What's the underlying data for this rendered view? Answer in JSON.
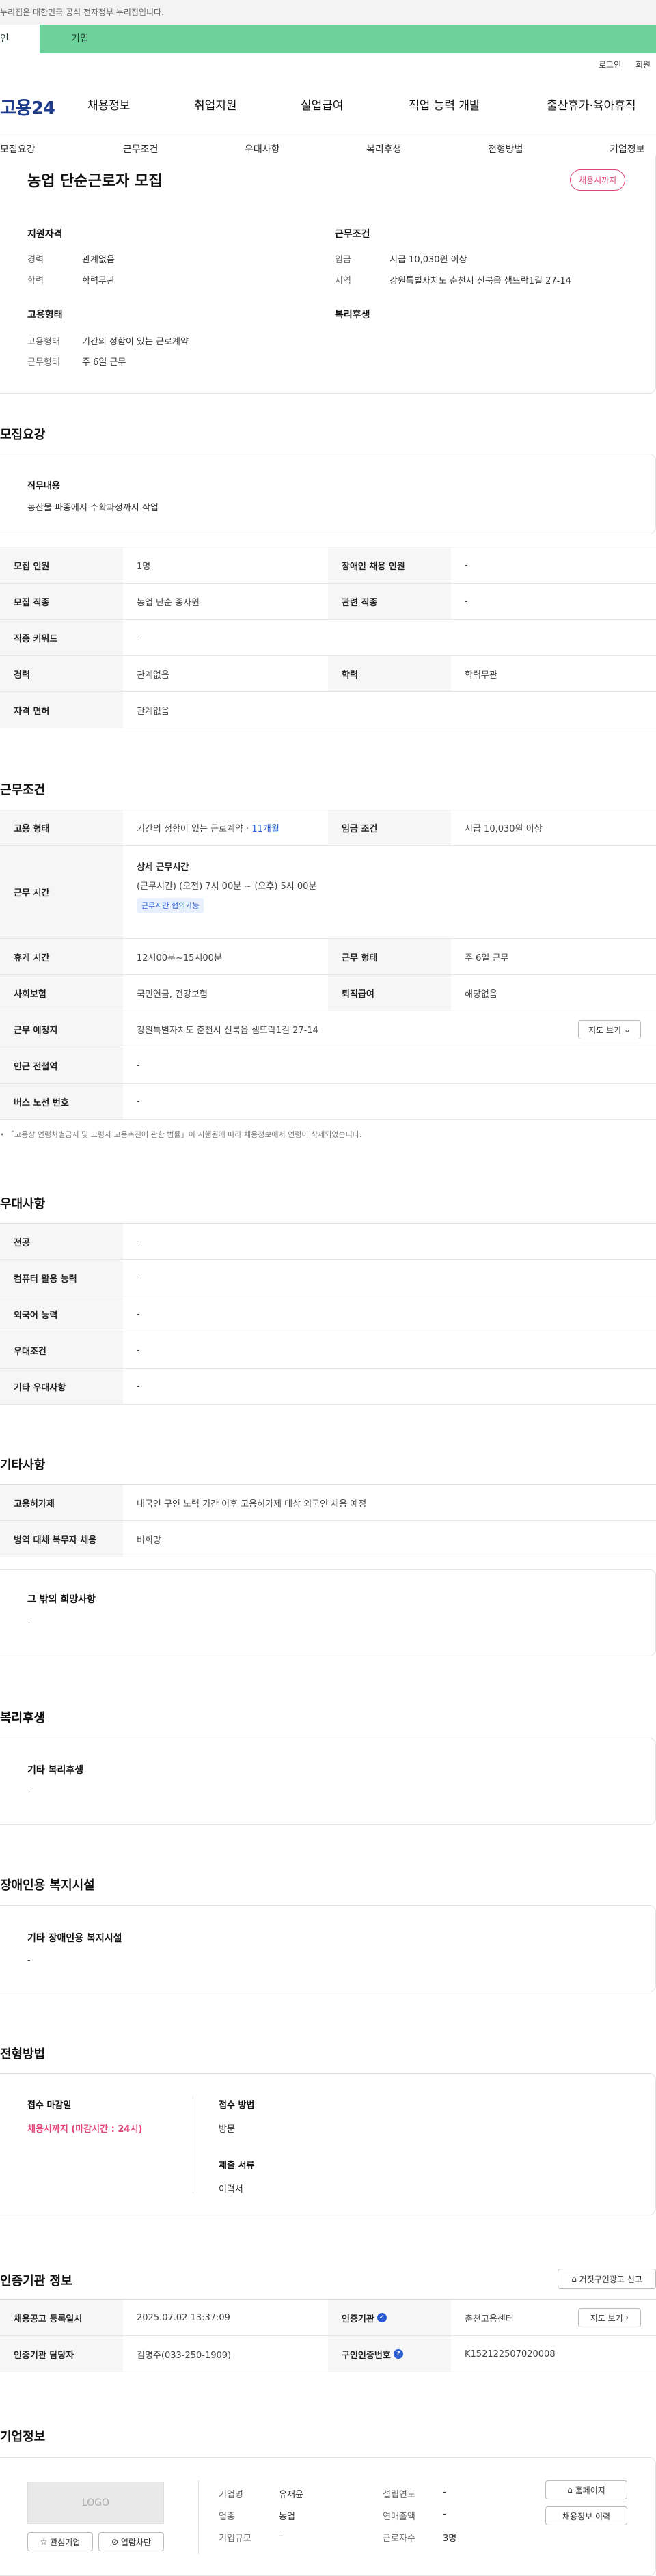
{
  "topbar": {
    "notice": "누리집은 대한민국 공식 전자정부 누리집입니다."
  },
  "tabs": [
    {
      "label": "인"
    },
    {
      "label": "기업"
    }
  ],
  "utility": {
    "login": "로그인",
    "join": "회원"
  },
  "brand": {
    "logo": "고용24"
  },
  "gnb": [
    "채용정보",
    "취업지원",
    "실업급여",
    "직업 능력 개발",
    "출산휴가·육아휴직"
  ],
  "subnav": [
    "모집요강",
    "근무조건",
    "우대사항",
    "복리후생",
    "전형방법",
    "기업정보"
  ],
  "job": {
    "title": "농업 단순근로자 모집",
    "status_badge": "채용시까지",
    "qual_title": "지원자격",
    "qual": [
      {
        "label": "경력",
        "value": "관계없음"
      },
      {
        "label": "학력",
        "value": "학력무관"
      }
    ],
    "cond_title": "근무조건",
    "cond": [
      {
        "label": "임금",
        "value": "시급 10,030원 이상"
      },
      {
        "label": "지역",
        "value": "강원특별자치도 춘천시 신북읍 샘뜨락1길 27-14"
      }
    ],
    "emp_title": "고용형태",
    "emp": [
      {
        "label": "고용형태",
        "value": "기간의 정함이 있는 근로계약"
      },
      {
        "label": "근무형태",
        "value": "주 6일 근무"
      }
    ],
    "welfare_title": "복리후생"
  },
  "recruit": {
    "section_title": "모집요강",
    "duty_title": "직무내용",
    "duty_text": "농산물 파종에서 수확과정까지 작업",
    "rows": [
      {
        "l1": "모집 인원",
        "v1": "1명",
        "l2": "장애인 채용 인원",
        "v2": "-"
      },
      {
        "l1": "모집 직종",
        "v1": "농업 단순 종사원",
        "l2": "관련 직종",
        "v2": "-"
      },
      {
        "l1": "직종 키워드",
        "v1": "-"
      },
      {
        "l1": "경력",
        "v1": "관계없음",
        "l2": "학력",
        "v2": "학력무관"
      },
      {
        "l1": "자격 면허",
        "v1": "관계없음"
      }
    ]
  },
  "work": {
    "section_title": "근무조건",
    "type_label": "고용 형태",
    "type_value": "기간의 정함이 있는 근로계약 · ",
    "type_months": "11개월",
    "wage_label": "임금 조건",
    "wage_value": "시급 10,030원 이상",
    "hours_label": "근무 시간",
    "hours_title": "상세 근무시간",
    "hours_value": "(근무시간) (오전) 7시 00분 ~ (오후) 5시 00분",
    "hours_chip": "근무시간 협의가능",
    "rest_label": "휴게 시간",
    "rest_value": "12시00분~15시00분",
    "shift_label": "근무 형태",
    "shift_value": "주 6일 근무",
    "ins_label": "사회보험",
    "ins_value": "국민연금, 건강보험",
    "sev_label": "퇴직급여",
    "sev_value": "해당없음",
    "place_label": "근무 예정지",
    "place_value": "강원특별자치도 춘천시 신북읍 샘뜨락1길 27-14",
    "map_btn": "지도 보기",
    "subway_label": "인근 전철역",
    "subway_value": "-",
    "bus_label": "버스 노선 번호",
    "bus_value": "-",
    "notice": "「고용상 연령차별금지 및 고령자 고용촉진에 관한 법률」이 시행됨에 따라 채용정보에서 연령이 삭제되었습니다."
  },
  "pref": {
    "section_title": "우대사항",
    "rows": [
      {
        "label": "전공",
        "value": "-"
      },
      {
        "label": "컴퓨터 활용 능력",
        "value": "-"
      },
      {
        "label": "외국어 능력",
        "value": "-"
      },
      {
        "label": "우대조건",
        "value": "-"
      },
      {
        "label": "기타 우대사항",
        "value": "-"
      }
    ]
  },
  "etc": {
    "section_title": "기타사항",
    "rows": [
      {
        "label": "고용허가제",
        "value": "내국인 구인 노력 기간 이후 고용허가제 대상 외국인 채용 예정"
      },
      {
        "label": "병역 대체 복무자 채용",
        "value": "비희망"
      }
    ],
    "other_title": "그 밖의 희망사항",
    "other_value": "-"
  },
  "benefit": {
    "section_title": "복리후생",
    "title": "기타 복리후생",
    "value": "-"
  },
  "disabled": {
    "section_title": "장애인용 복지시설",
    "title": "기타 장애인용 복지시설",
    "value": "-"
  },
  "process": {
    "section_title": "전형방법",
    "deadline_title": "접수 마감일",
    "deadline_value": "채용시까지 (마감시간 : 24시)",
    "method_title": "접수 방법",
    "method_value": "방문",
    "docs_title": "제출 서류",
    "docs_value": "이력서"
  },
  "cert": {
    "section_title": "인증기관 정보",
    "report_btn": "거짓구인광고 신고",
    "reg_label": "채용공고 등록일시",
    "reg_value": "2025.07.02 13:37:09",
    "org_label": "인증기관",
    "org_value": "춘천고용센터",
    "map_btn": "지도 보기",
    "mgr_label": "인증기관 담당자",
    "mgr_value": "김명주(033-250-1909)",
    "num_label": "구인인증번호",
    "num_value": "K152122507020008"
  },
  "company": {
    "section_title": "기업정보",
    "logo_text": "LOGO",
    "fav_btn": "관심기업",
    "block_btn": "열람차단",
    "fields": [
      {
        "label": "기업명",
        "value": "유재윤"
      },
      {
        "label": "업종",
        "value": "농업"
      },
      {
        "label": "기업규모",
        "value": "-"
      },
      {
        "label": "설립연도",
        "value": "-"
      },
      {
        "label": "연매출액",
        "value": "-"
      },
      {
        "label": "근로자수",
        "value": "3명"
      }
    ],
    "home_btn": "홈페이지",
    "jobs_btn": "채용정보 이력"
  }
}
